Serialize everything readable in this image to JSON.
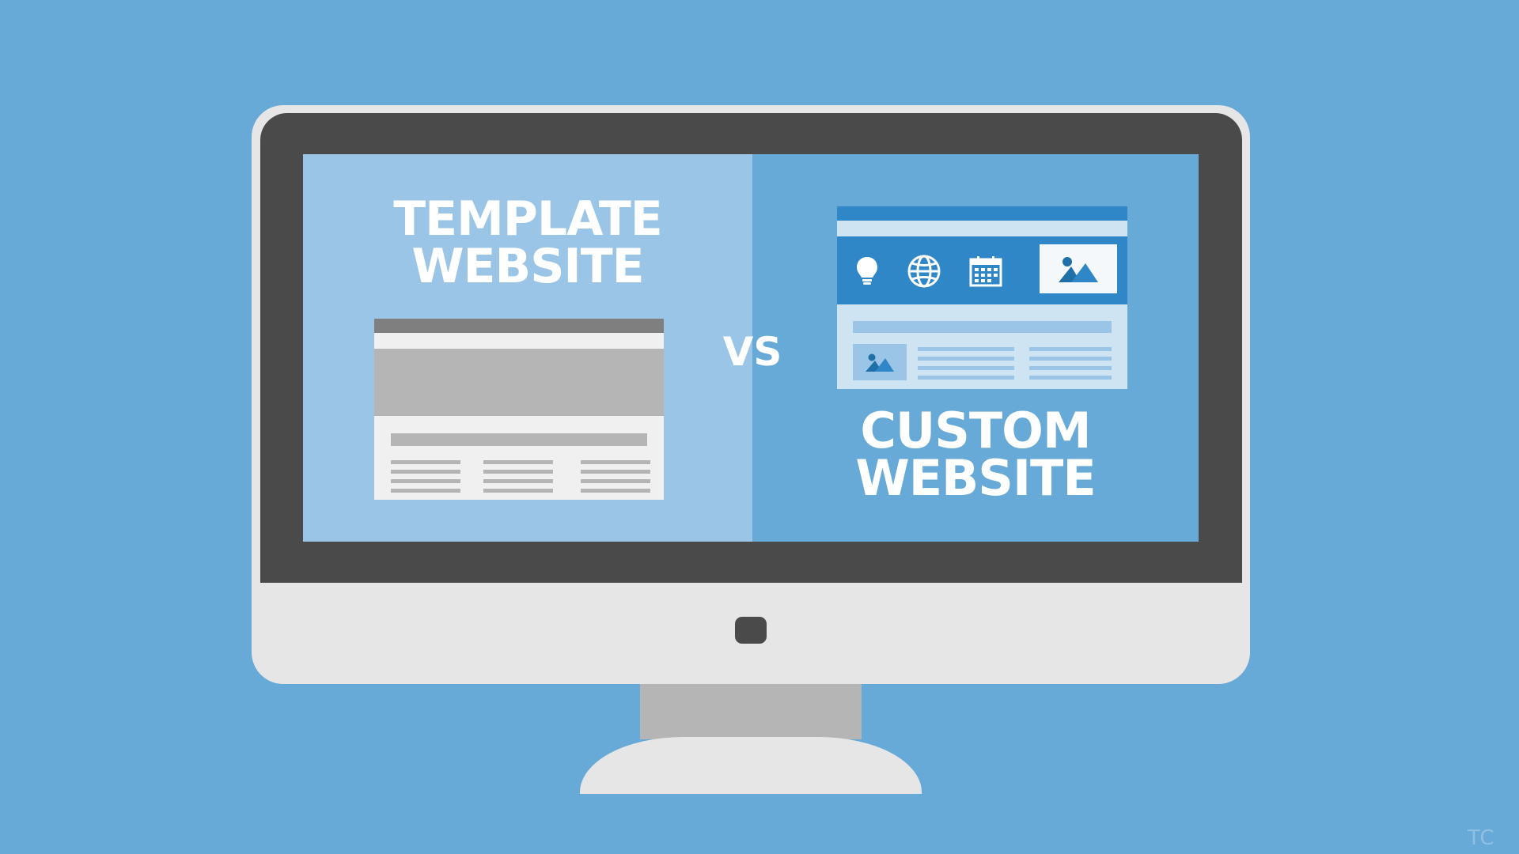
{
  "screen_left": {
    "heading": [
      "TEMPLATE",
      "WEBSITE"
    ]
  },
  "screen_right": {
    "heading": [
      "CUSTOM",
      "WEBSITE"
    ]
  },
  "versus": "VS",
  "custom_icons": [
    "lightbulb-icon",
    "globe-icon",
    "calendar-icon",
    "image-icon"
  ],
  "watermark": "TC",
  "colors": {
    "background": "#67a9d7",
    "screen_left": "#9ac5e6",
    "screen_right": "#67a9d7",
    "bezel": "#4a4a4a",
    "monitor_body": "#e6e6e6",
    "stand_neck": "#b5b5b5",
    "template_gray": "#b5b5b5",
    "custom_blue": "#2f87c8"
  }
}
